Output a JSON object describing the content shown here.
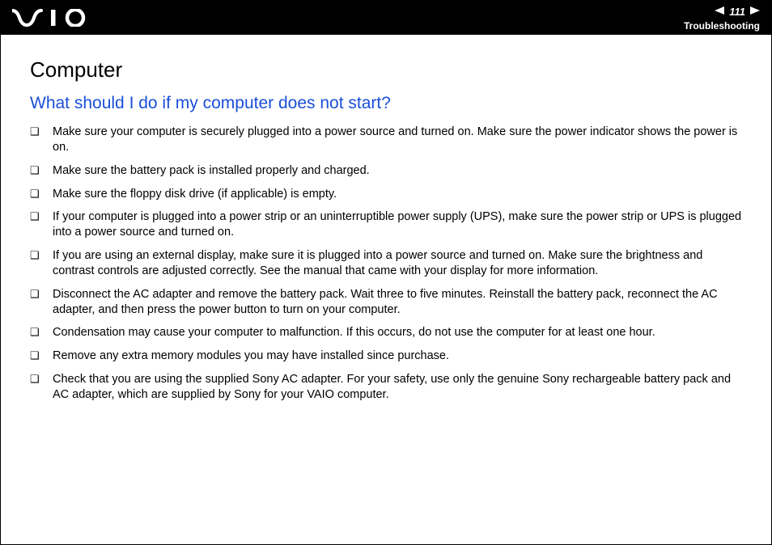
{
  "header": {
    "page_number": "111",
    "section": "Troubleshooting"
  },
  "content": {
    "title": "Computer",
    "question": "What should I do if my computer does not start?",
    "items": [
      "Make sure your computer is securely plugged into a power source and turned on. Make sure the power indicator shows the power is on.",
      "Make sure the battery pack is installed properly and charged.",
      "Make sure the floppy disk drive (if applicable) is empty.",
      "If your computer is plugged into a power strip or an uninterruptible power supply (UPS), make sure the power strip or UPS is plugged into a power source and turned on.",
      "If you are using an external display, make sure it is plugged into a power source and turned on. Make sure the brightness and contrast controls are adjusted correctly. See the manual that came with your display for more information.",
      "Disconnect the AC adapter and remove the battery pack. Wait three to five minutes. Reinstall the battery pack, reconnect the AC adapter, and then press the power button to turn on your computer.",
      "Condensation may cause your computer to malfunction. If this occurs, do not use the computer for at least one hour.",
      "Remove any extra memory modules you may have installed since purchase.",
      "Check that you are using the supplied Sony AC adapter. For your safety, use only the genuine Sony rechargeable battery pack and AC adapter, which are supplied by Sony for your VAIO computer."
    ]
  }
}
